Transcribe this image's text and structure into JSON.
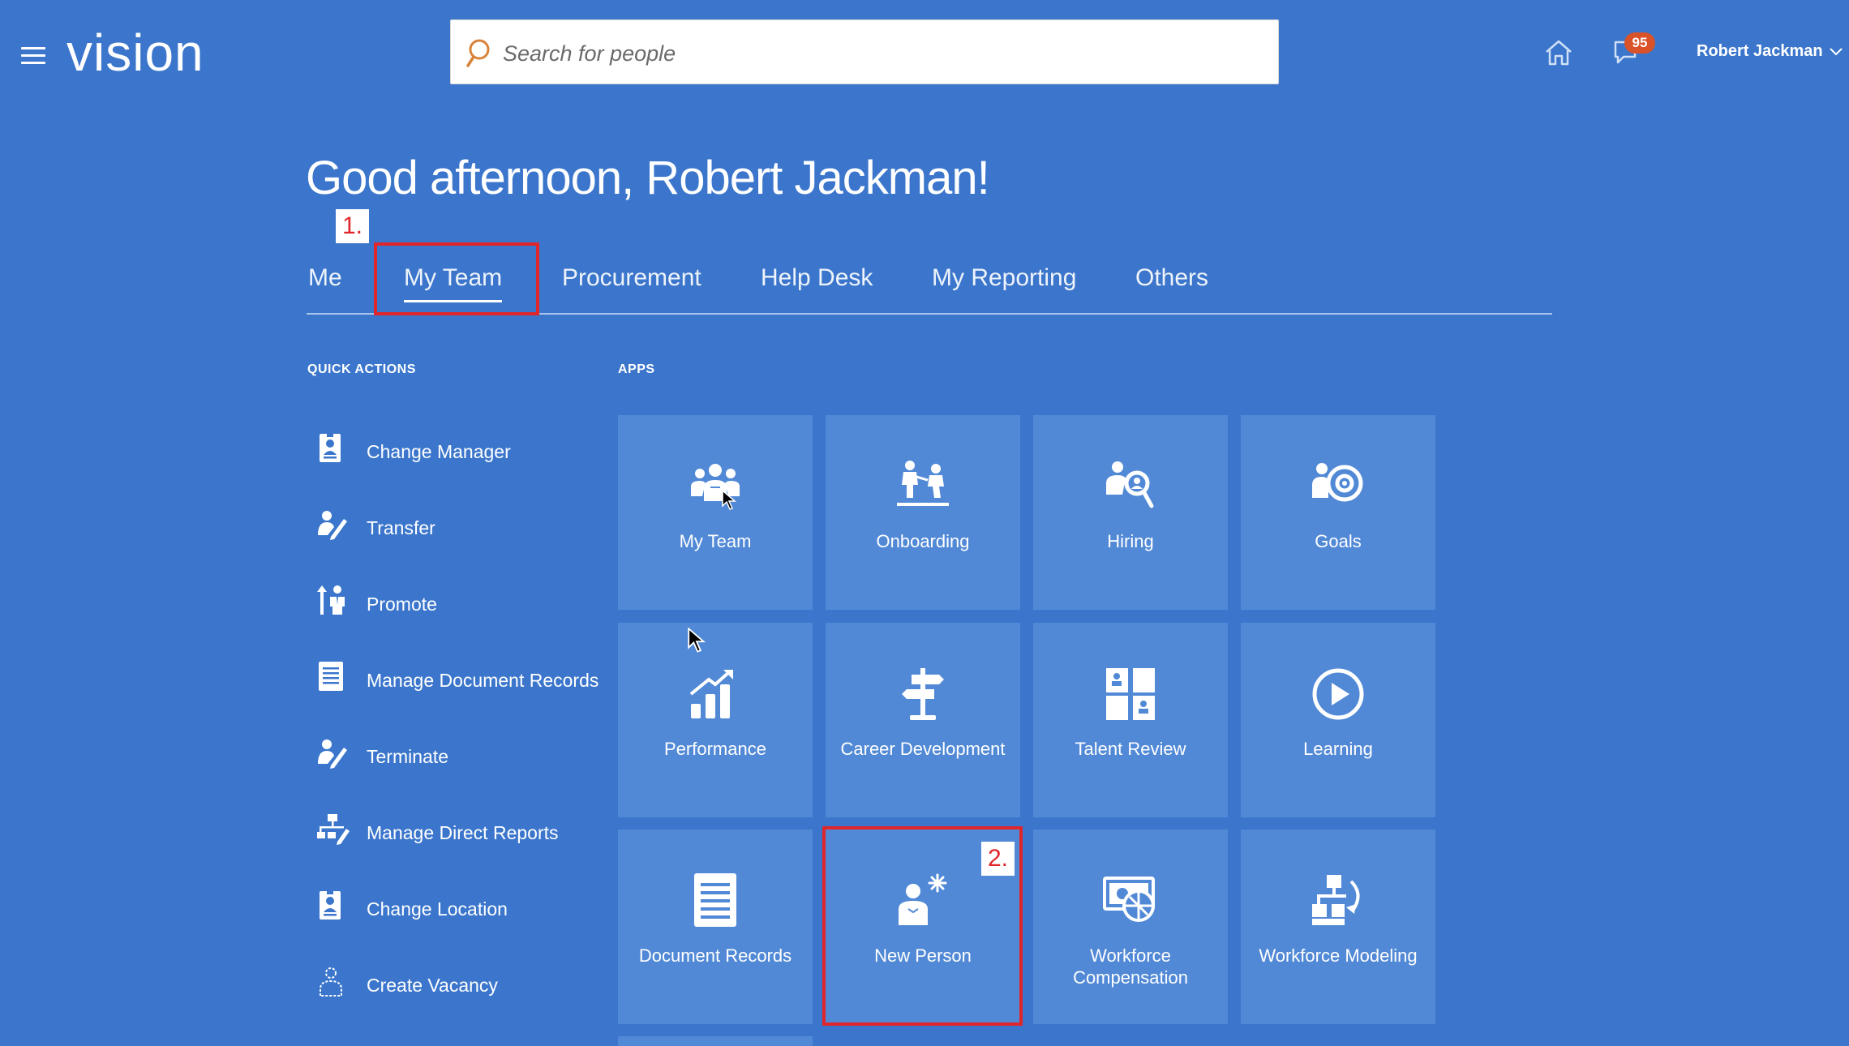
{
  "header": {
    "logo": "vision",
    "search_placeholder": "Search for people",
    "notification_count": "95",
    "user_name": "Robert Jackman"
  },
  "greeting": "Good afternoon, Robert Jackman!",
  "tabs": [
    {
      "label": "Me"
    },
    {
      "label": "My Team"
    },
    {
      "label": "Procurement"
    },
    {
      "label": "Help Desk"
    },
    {
      "label": "My Reporting"
    },
    {
      "label": "Others"
    }
  ],
  "annotations": {
    "step1": "1.",
    "step2": "2."
  },
  "quick_actions": {
    "heading": "QUICK ACTIONS",
    "items": [
      {
        "label": "Change Manager",
        "icon": "badge-icon"
      },
      {
        "label": "Transfer",
        "icon": "person-edit-icon"
      },
      {
        "label": "Promote",
        "icon": "promote-icon"
      },
      {
        "label": "Manage Document Records",
        "icon": "document-icon"
      },
      {
        "label": "Terminate",
        "icon": "person-edit-icon"
      },
      {
        "label": "Manage Direct Reports",
        "icon": "org-chart-icon"
      },
      {
        "label": "Change Location",
        "icon": "badge-icon"
      },
      {
        "label": "Create Vacancy",
        "icon": "vacancy-icon"
      }
    ]
  },
  "apps": {
    "heading": "APPS",
    "items": [
      {
        "label": "My Team",
        "icon": "team-icon"
      },
      {
        "label": "Onboarding",
        "icon": "onboarding-icon"
      },
      {
        "label": "Hiring",
        "icon": "hiring-icon"
      },
      {
        "label": "Goals",
        "icon": "goals-icon"
      },
      {
        "label": "Performance",
        "icon": "performance-icon"
      },
      {
        "label": "Career Development",
        "icon": "signpost-icon"
      },
      {
        "label": "Talent Review",
        "icon": "talent-review-icon"
      },
      {
        "label": "Learning",
        "icon": "play-icon"
      },
      {
        "label": "Document Records",
        "icon": "document-icon"
      },
      {
        "label": "New Person",
        "icon": "new-person-icon"
      },
      {
        "label": "Workforce Compensation",
        "icon": "compensation-icon"
      },
      {
        "label": "Workforce Modeling",
        "icon": "modeling-icon"
      }
    ]
  },
  "colors": {
    "background": "#3b76cc",
    "tile": "#5189d6",
    "annotation_red": "#e0262b",
    "badge": "#d9522a"
  }
}
